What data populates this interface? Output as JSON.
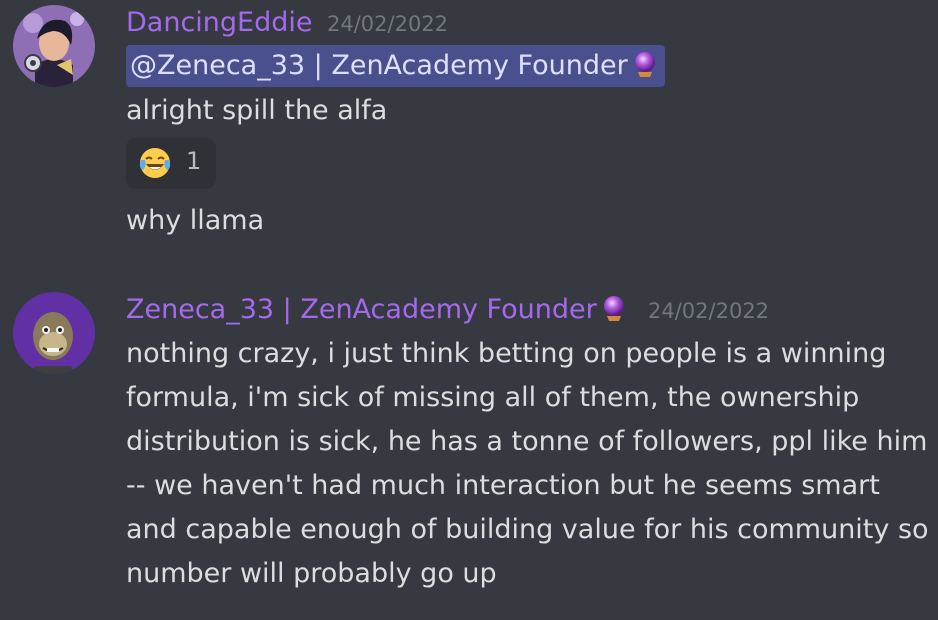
{
  "messages": [
    {
      "author": "DancingEddie",
      "timestamp": "24/02/2022",
      "mention": "@Zeneca_33 | ZenAcademy Founder",
      "mention_badge_icon": "crystal-ball-icon",
      "lines": [
        "alright spill the alfa"
      ],
      "reaction": {
        "emoji": "joy-emoji-icon",
        "count": "1"
      },
      "followup": "why llama",
      "colors": {
        "author": "#a569f0"
      }
    },
    {
      "author": "Zeneca_33 | ZenAcademy Founder",
      "author_badge_icon": "crystal-ball-icon",
      "timestamp": "24/02/2022",
      "lines": [
        "nothing crazy, i just think betting on people is a winning",
        "formula, i'm sick of missing all of them, the ownership",
        "distribution is sick, he has a tonne of followers, ppl like him",
        "-- we haven't had much interaction but he seems smart",
        "and capable enough of building value for his community so",
        "number will probably go up"
      ],
      "colors": {
        "author": "#a569f0"
      }
    }
  ],
  "theme": {
    "background": "#36393f",
    "text": "#dcddde",
    "muted": "#72767d",
    "mention_bg": "#4a4f8e",
    "reaction_bg": "#2f3136"
  }
}
